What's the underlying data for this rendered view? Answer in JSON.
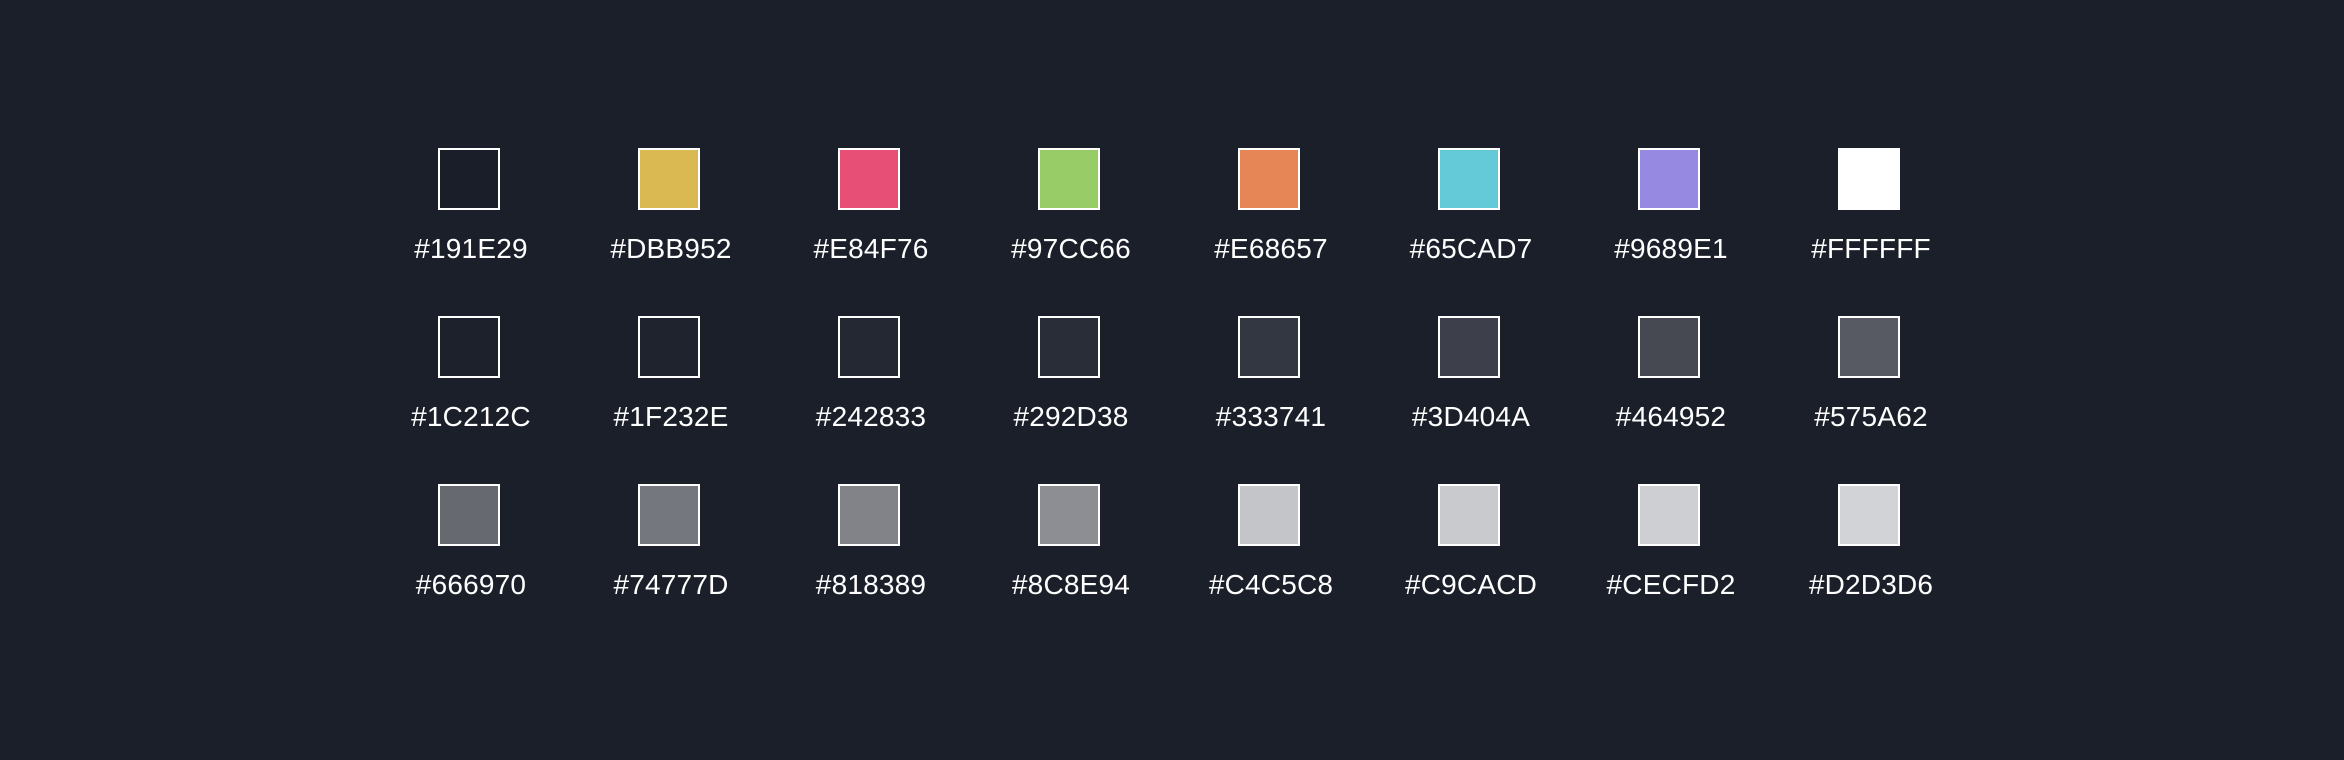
{
  "palette": {
    "rows": [
      [
        {
          "label": "#191E29",
          "color": "#191E29"
        },
        {
          "label": "#DBB952",
          "color": "#DBB952"
        },
        {
          "label": "#E84F76",
          "color": "#E84F76"
        },
        {
          "label": "#97CC66",
          "color": "#97CC66"
        },
        {
          "label": "#E68657",
          "color": "#E68657"
        },
        {
          "label": "#65CAD7",
          "color": "#65CAD7"
        },
        {
          "label": "#9689E1",
          "color": "#9689E1"
        },
        {
          "label": "#FFFFFF",
          "color": "#FFFFFF"
        }
      ],
      [
        {
          "label": "#1C212C",
          "color": "#1C212C"
        },
        {
          "label": "#1F232E",
          "color": "#1F232E"
        },
        {
          "label": "#242833",
          "color": "#242833"
        },
        {
          "label": "#292D38",
          "color": "#292D38"
        },
        {
          "label": "#333741",
          "color": "#333741"
        },
        {
          "label": "#3D404A",
          "color": "#3D404A"
        },
        {
          "label": "#464952",
          "color": "#464952"
        },
        {
          "label": "#575A62",
          "color": "#575A62"
        }
      ],
      [
        {
          "label": "#666970",
          "color": "#666970"
        },
        {
          "label": "#74777D",
          "color": "#74777D"
        },
        {
          "label": "#818389",
          "color": "#818389"
        },
        {
          "label": "#8C8E94",
          "color": "#8C8E94"
        },
        {
          "label": "#C4C5C8",
          "color": "#C4C5C8"
        },
        {
          "label": "#C9CACD",
          "color": "#C9CACD"
        },
        {
          "label": "#CECFD2",
          "color": "#CECFD2"
        },
        {
          "label": "#D2D3D6",
          "color": "#D2D3D6"
        }
      ]
    ]
  }
}
